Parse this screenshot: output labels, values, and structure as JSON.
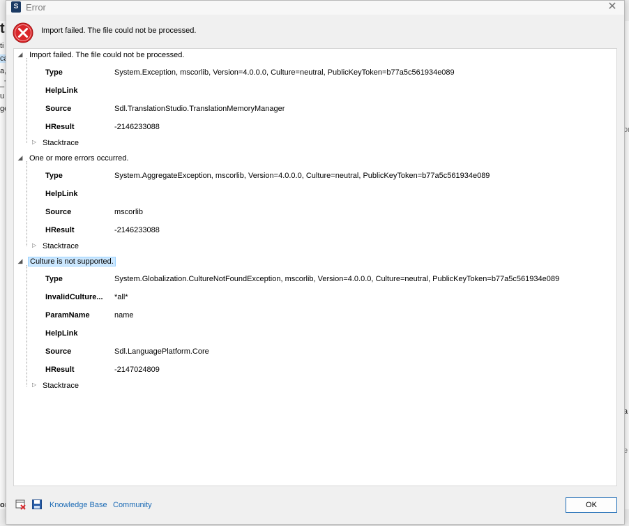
{
  "background": {
    "left_fragments": [
      "ti",
      "ca",
      "a,",
      "_T",
      "u",
      "ge"
    ],
    "left_big_letter": "t",
    "bottom_left": "on",
    "right_fragments": [
      "or",
      "a",
      "e"
    ]
  },
  "dialog": {
    "app_logo": "S",
    "title": "Error",
    "header_message": "Import failed. The file could not be processed."
  },
  "tree": {
    "nodes": [
      {
        "label": "Import failed. The file could not be processed.",
        "props": [
          {
            "name": "Type",
            "value": "System.Exception, mscorlib, Version=4.0.0.0, Culture=neutral, PublicKeyToken=b77a5c561934e089"
          },
          {
            "name": "HelpLink",
            "value": ""
          },
          {
            "name": "Source",
            "value": "Sdl.TranslationStudio.TranslationMemoryManager"
          },
          {
            "name": "HResult",
            "value": "-2146233088"
          }
        ],
        "stacktrace": "Stacktrace"
      },
      {
        "label": "One or more errors occurred.",
        "props": [
          {
            "name": "Type",
            "value": "System.AggregateException, mscorlib, Version=4.0.0.0, Culture=neutral, PublicKeyToken=b77a5c561934e089"
          },
          {
            "name": "HelpLink",
            "value": ""
          },
          {
            "name": "Source",
            "value": "mscorlib"
          },
          {
            "name": "HResult",
            "value": "-2146233088"
          }
        ],
        "stacktrace": "Stacktrace"
      },
      {
        "label": "Culture is not supported.",
        "props": [
          {
            "name": "Type",
            "value": "System.Globalization.CultureNotFoundException, mscorlib, Version=4.0.0.0, Culture=neutral, PublicKeyToken=b77a5c561934e089"
          },
          {
            "name": "InvalidCulture...",
            "value": "*all*"
          },
          {
            "name": "ParamName",
            "value": "name"
          },
          {
            "name": "HelpLink",
            "value": ""
          },
          {
            "name": "Source",
            "value": "Sdl.LanguagePlatform.Core"
          },
          {
            "name": "HResult",
            "value": "-2147024809"
          }
        ],
        "stacktrace": "Stacktrace"
      }
    ]
  },
  "footer": {
    "knowledge_base": "Knowledge Base",
    "community": "Community",
    "ok": "OK"
  },
  "colors": {
    "link": "#1a6ab5",
    "selection": "#cce8ff",
    "error_icon": "#d9262a"
  }
}
